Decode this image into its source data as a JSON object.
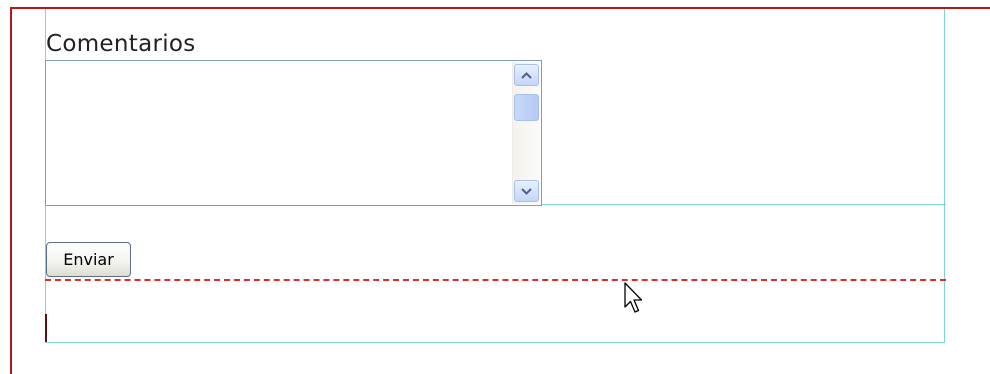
{
  "form": {
    "comments_label": "Comentarios",
    "comments_value": "",
    "submit_label": "Enviar"
  },
  "icons": {
    "scroll_up": "chevron-up-icon",
    "scroll_down": "chevron-down-icon",
    "pointer": "mouse-pointer-icon"
  },
  "colors": {
    "outer_border": "#b21a1a",
    "frame_border": "#7fd4d4",
    "dashed_line": "#e02b2b",
    "textarea_border": "#7f9db9",
    "scrollbar_accent": "#c3d5f8"
  }
}
